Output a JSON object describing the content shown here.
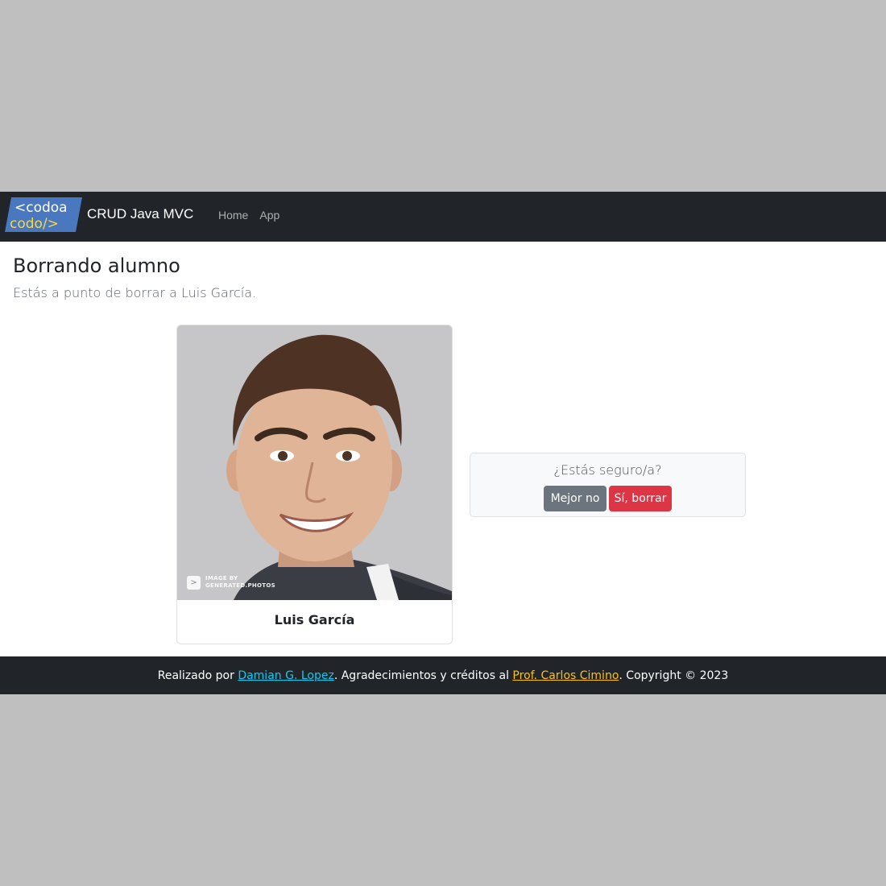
{
  "navbar": {
    "logo": {
      "line1": "<codoa",
      "line2": "codo/>"
    },
    "brand": "CRUD Java MVC",
    "links": [
      "Home",
      "App"
    ]
  },
  "main": {
    "title": "Borrando alumno",
    "lead": "Estás a punto de borrar a Luis García."
  },
  "student": {
    "name": "Luis García",
    "photo_watermark": {
      "icon": ">",
      "line1": "IMAGE BY",
      "line2": "GENERATED.PHOTOS"
    }
  },
  "confirm": {
    "question": "¿Estás seguro/a?",
    "cancel_label": "Mejor no",
    "delete_label": "Sí, borrar"
  },
  "footer": {
    "prefix": "Realizado por ",
    "author_link": "Damian G. Lopez",
    "middle": ". Agradecimientos y créditos al ",
    "credit_link": "Prof. Carlos Cimino",
    "suffix": ". Copyright © 2023"
  },
  "colors": {
    "navbar_bg": "#212529",
    "secondary": "#6c757d",
    "danger": "#dc3545",
    "info": "#0dcaf0",
    "warning": "#ffc107"
  }
}
